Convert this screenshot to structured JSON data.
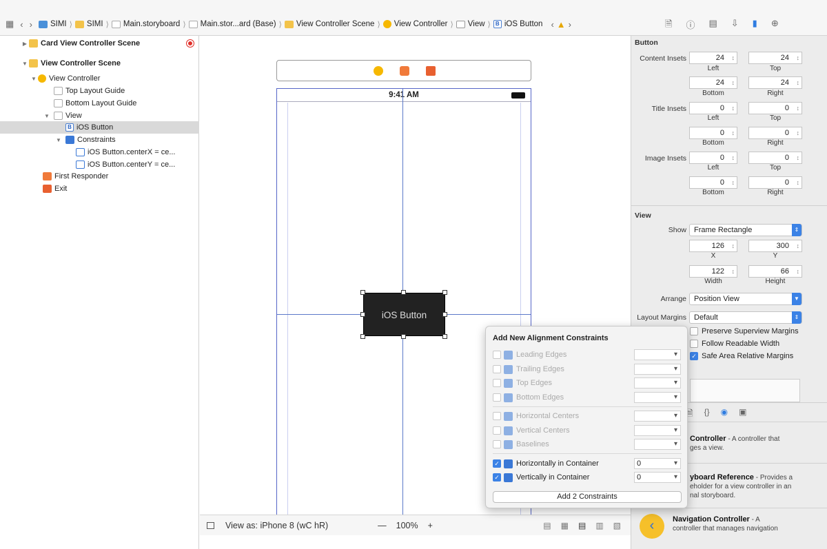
{
  "jumpbar": {
    "crumbs": [
      "SIMI",
      "SIMI",
      "Main.storyboard",
      "Main.stor...ard (Base)",
      "View Controller Scene",
      "View Controller",
      "View",
      "iOS Button"
    ]
  },
  "outline": {
    "items": [
      {
        "label": "Card View Controller Scene"
      },
      {
        "label": "View Controller Scene"
      },
      {
        "label": "View Controller"
      },
      {
        "label": "Top Layout Guide"
      },
      {
        "label": "Bottom Layout Guide"
      },
      {
        "label": "View"
      },
      {
        "label": "iOS Button"
      },
      {
        "label": "Constraints"
      },
      {
        "label": "iOS Button.centerX = ce..."
      },
      {
        "label": "iOS Button.centerY = ce..."
      },
      {
        "label": "First Responder"
      },
      {
        "label": "Exit"
      }
    ]
  },
  "canvas": {
    "status_time": "9:41 AM",
    "button_title": "iOS Button"
  },
  "bottombar": {
    "view_as": "View as: iPhone 8 (wC hR)",
    "zoom_minus": "—",
    "zoom": "100%",
    "zoom_plus": "+"
  },
  "inspector": {
    "button_header": "Button",
    "content_insets_label": "Content Insets",
    "title_insets_label": "Title Insets",
    "image_insets_label": "Image Insets",
    "content_insets": [
      "24",
      "24",
      "24",
      "24"
    ],
    "title_insets": [
      "0",
      "0",
      "0",
      "0"
    ],
    "image_insets": [
      "0",
      "0",
      "0",
      "0"
    ],
    "sub_labels": {
      "left": "Left",
      "top": "Top",
      "bottom": "Bottom",
      "right": "Right"
    },
    "view_header": "View",
    "show_label": "Show",
    "show_value": "Frame Rectangle",
    "frame": {
      "x": "126",
      "y": "300",
      "width": "122",
      "height": "66"
    },
    "frame_labels": {
      "x": "X",
      "y": "Y",
      "width": "Width",
      "height": "Height"
    },
    "arrange_label": "Arrange",
    "arrange_value": "Position View",
    "layout_margins_label": "Layout Margins",
    "layout_margins_value": "Default",
    "checks": [
      {
        "label": "Preserve Superview Margins",
        "checked": false
      },
      {
        "label": "Follow Readable Width",
        "checked": false
      },
      {
        "label": "Safe Area Relative Margins",
        "checked": true
      }
    ]
  },
  "library": {
    "items": [
      {
        "title": "Controller",
        "desc": " - A controller that",
        "desc2": "ges a view."
      },
      {
        "title": "yboard Reference",
        "desc": " - Provides a",
        "desc2": "eholder for a view controller in an",
        "desc3": "nal storyboard."
      },
      {
        "title": "Navigation Controller",
        "desc": " - A",
        "desc2": "controller that manages navigation"
      }
    ]
  },
  "popover": {
    "title": "Add New Alignment Constraints",
    "rows": [
      {
        "label": "Leading Edges",
        "enabled": false,
        "checked": false,
        "value": ""
      },
      {
        "label": "Trailing Edges",
        "enabled": false,
        "checked": false,
        "value": ""
      },
      {
        "label": "Top Edges",
        "enabled": false,
        "checked": false,
        "value": ""
      },
      {
        "label": "Bottom Edges",
        "enabled": false,
        "checked": false,
        "value": ""
      },
      {
        "label": "Horizontal Centers",
        "enabled": false,
        "checked": false,
        "value": ""
      },
      {
        "label": "Vertical Centers",
        "enabled": false,
        "checked": false,
        "value": ""
      },
      {
        "label": "Baselines",
        "enabled": false,
        "checked": false,
        "value": ""
      },
      {
        "label": "Horizontally in Container",
        "enabled": true,
        "checked": true,
        "value": "0"
      },
      {
        "label": "Vertically in Container",
        "enabled": true,
        "checked": true,
        "value": "0"
      }
    ],
    "add_button": "Add 2 Constraints"
  }
}
